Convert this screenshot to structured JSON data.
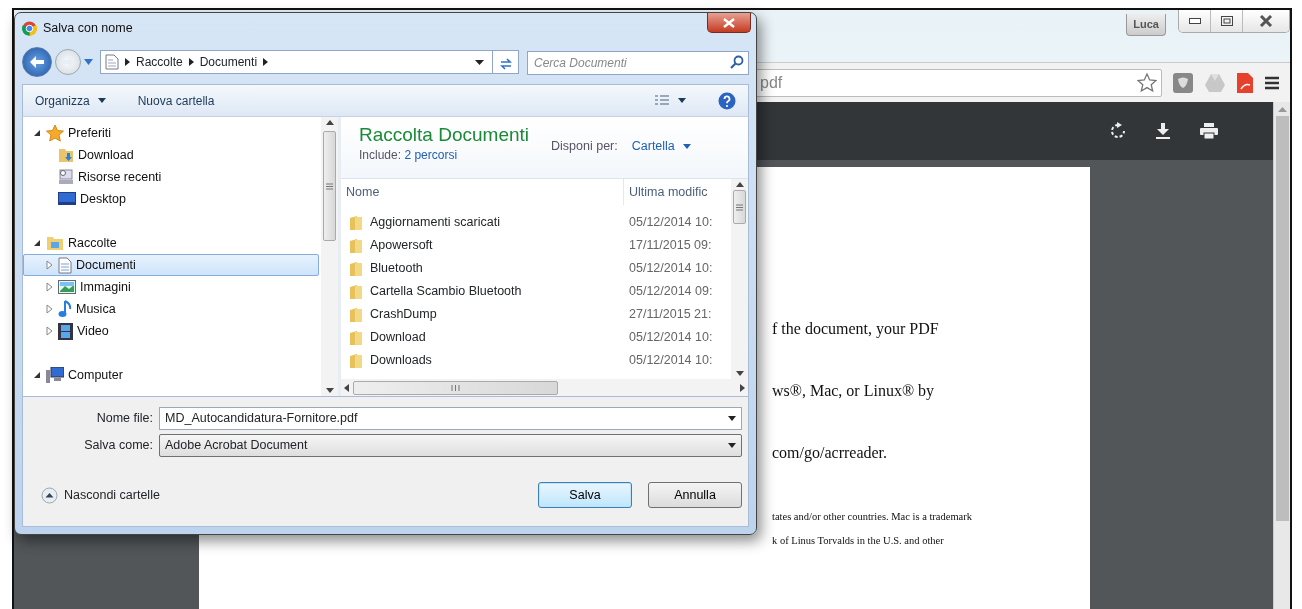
{
  "browser": {
    "profile": "Luca",
    "address": "pdf",
    "pdf_lines": [
      {
        "text": "f the document, your PDF",
        "kind": "body"
      },
      {
        "text": "ws®, Mac, or Linux® by",
        "kind": "body"
      },
      {
        "text": "com/go/acrreader.",
        "kind": "body"
      },
      {
        "text": "tates and/or other countries. Mac is a trademark",
        "kind": "note"
      },
      {
        "text": "k of Linus Torvalds in the U.S. and other",
        "kind": "note"
      }
    ]
  },
  "dialog": {
    "title": "Salva con nome",
    "breadcrumb": [
      "Raccolte",
      "Documenti"
    ],
    "search_placeholder": "Cerca Documenti",
    "toolbar": [
      {
        "label": "Organizza",
        "kind": "menu"
      },
      {
        "label": "Nuova cartella",
        "kind": "button"
      }
    ],
    "tree": [
      {
        "label": "Preferiti",
        "expanded": true,
        "selected": false,
        "children": [
          {
            "label": "Download",
            "selected": false
          },
          {
            "label": "Risorse recenti",
            "selected": false
          },
          {
            "label": "Desktop",
            "selected": false
          }
        ]
      },
      {
        "label": "Raccolte",
        "expanded": true,
        "selected": false,
        "children": [
          {
            "label": "Documenti",
            "expanded": false,
            "selected": true
          },
          {
            "label": "Immagini",
            "expanded": false,
            "selected": false
          },
          {
            "label": "Musica",
            "expanded": false,
            "selected": false
          },
          {
            "label": "Video",
            "expanded": false,
            "selected": false
          }
        ]
      },
      {
        "label": "Computer",
        "expanded": true,
        "selected": false
      }
    ],
    "library": {
      "title": "Raccolta Documenti",
      "include_label": "Include:",
      "include_link": "2 percorsi",
      "arrange_label": "Disponi per:",
      "arrange_value": "Cartella"
    },
    "columns": [
      "Nome",
      "Ultima modific"
    ],
    "rows": [
      {
        "name": "Aggiornamenti scaricati",
        "date": "05/12/2014 10:"
      },
      {
        "name": "Apowersoft",
        "date": "17/11/2015 09:"
      },
      {
        "name": "Bluetooth",
        "date": "05/12/2014 10:"
      },
      {
        "name": "Cartella Scambio Bluetooth",
        "date": "05/12/2014 09:"
      },
      {
        "name": "CrashDump",
        "date": "27/11/2015 21:"
      },
      {
        "name": "Download",
        "date": "05/12/2014 10:"
      },
      {
        "name": "Downloads",
        "date": "05/12/2014 10:"
      }
    ],
    "fields": [
      {
        "label": "Nome file:",
        "value": "MD_Autocandidatura-Fornitore.pdf",
        "kind": "combo"
      },
      {
        "label": "Salva come:",
        "value": "Adobe Acrobat Document",
        "kind": "select"
      }
    ],
    "hide_folders": "Nascondi cartelle",
    "buttons": [
      {
        "label": "Salva",
        "default": true
      },
      {
        "label": "Annulla",
        "default": false
      }
    ]
  }
}
